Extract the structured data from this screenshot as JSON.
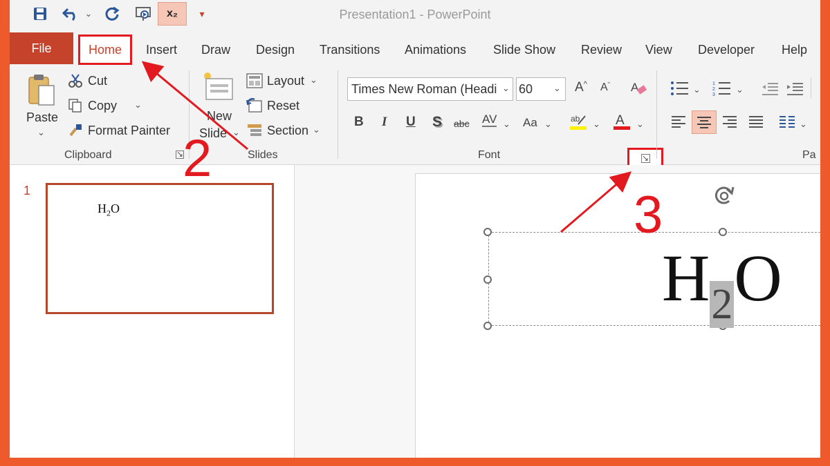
{
  "window": {
    "title": "Presentation1  -  PowerPoint"
  },
  "quick_access": {
    "subscript_label": "x₂"
  },
  "tabs": [
    {
      "label": "File"
    },
    {
      "label": "Home"
    },
    {
      "label": "Insert"
    },
    {
      "label": "Draw"
    },
    {
      "label": "Design"
    },
    {
      "label": "Transitions"
    },
    {
      "label": "Animations"
    },
    {
      "label": "Slide Show"
    },
    {
      "label": "Review"
    },
    {
      "label": "View"
    },
    {
      "label": "Developer"
    },
    {
      "label": "Help"
    }
  ],
  "clipboard": {
    "paste": "Paste",
    "cut": "Cut",
    "copy": "Copy",
    "format_painter": "Format Painter",
    "group": "Clipboard"
  },
  "slides_group": {
    "new_slide_1": "New",
    "new_slide_2": "Slide",
    "layout": "Layout",
    "reset": "Reset",
    "section": "Section",
    "group": "Slides"
  },
  "font_group": {
    "font_name": "Times New Roman (Headi",
    "font_size": "60",
    "bold": "B",
    "italic": "I",
    "underline": "U",
    "shadow": "S",
    "strike": "abc",
    "spacing": "AV",
    "case": "Aa",
    "group": "Font"
  },
  "paragraph_group": {
    "group_partial": "Pa"
  },
  "thumbnail": {
    "number": "1",
    "text_main": "H",
    "text_sub": "2",
    "text_end": "O"
  },
  "slide": {
    "text_main": "H",
    "text_sub": "2",
    "text_end": "O"
  },
  "annotations": {
    "step2": "2",
    "step3": "3"
  },
  "colors": {
    "accent": "#c6432b",
    "highlight_red": "#e2191f",
    "frame": "#ee5a2b"
  }
}
